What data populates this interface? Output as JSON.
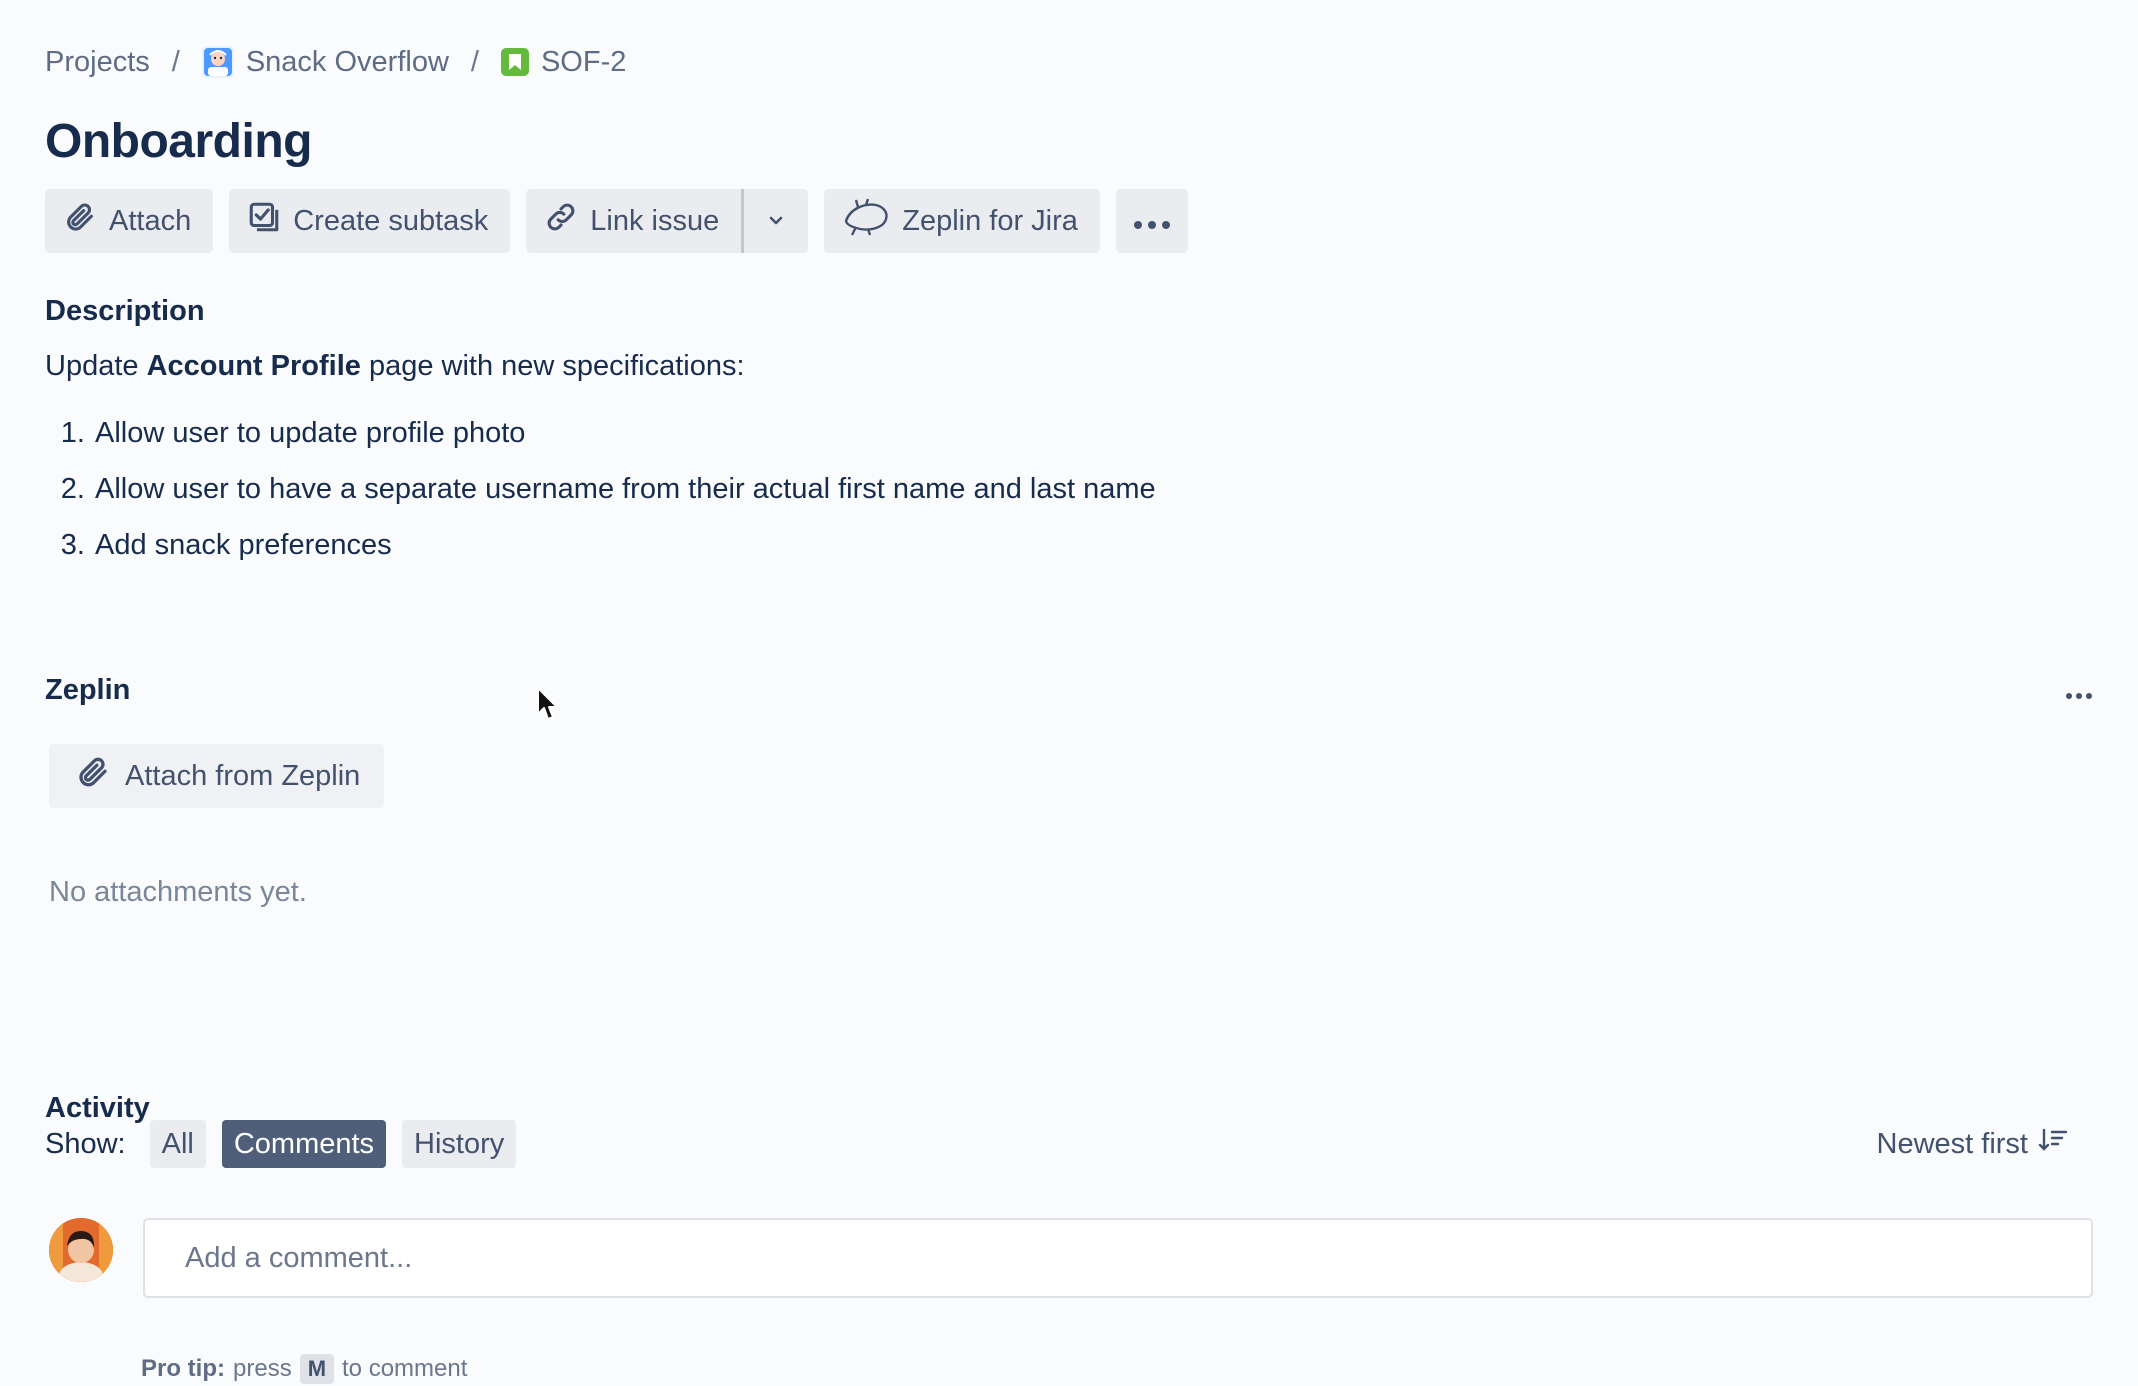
{
  "breadcrumb": {
    "projects": "Projects",
    "separator": "/",
    "project_name": "Snack Overflow",
    "issue_key": "SOF-2"
  },
  "issue": {
    "title": "Onboarding"
  },
  "toolbar": {
    "attach": "Attach",
    "create_subtask": "Create subtask",
    "link_issue": "Link issue",
    "zeplin_for_jira": "Zeplin for Jira"
  },
  "description": {
    "label": "Description",
    "text_before": "Update ",
    "text_bold": "Account Profile",
    "text_after": " page with new specifications:",
    "items": [
      "Allow user to update profile photo",
      "Allow user to have a separate username from their actual first name and last name",
      "Add snack preferences"
    ]
  },
  "zeplin": {
    "label": "Zeplin",
    "attach_button": "Attach from Zeplin",
    "empty_text": "No attachments yet."
  },
  "activity": {
    "label": "Activity",
    "show_label": "Show:",
    "filters": [
      "All",
      "Comments",
      "History"
    ],
    "active_filter": "Comments",
    "sort_label": "Newest first",
    "comment_placeholder": "Add a comment...",
    "pro_tip_label": "Pro tip:",
    "pro_tip_press": "press",
    "pro_tip_key": "M",
    "pro_tip_suffix": "to comment"
  },
  "colors": {
    "text_primary": "#172b4d",
    "text_secondary": "#42526e",
    "button_bg": "#ebecf0",
    "active_chip": "#505f79",
    "story_green": "#63ba3c"
  }
}
